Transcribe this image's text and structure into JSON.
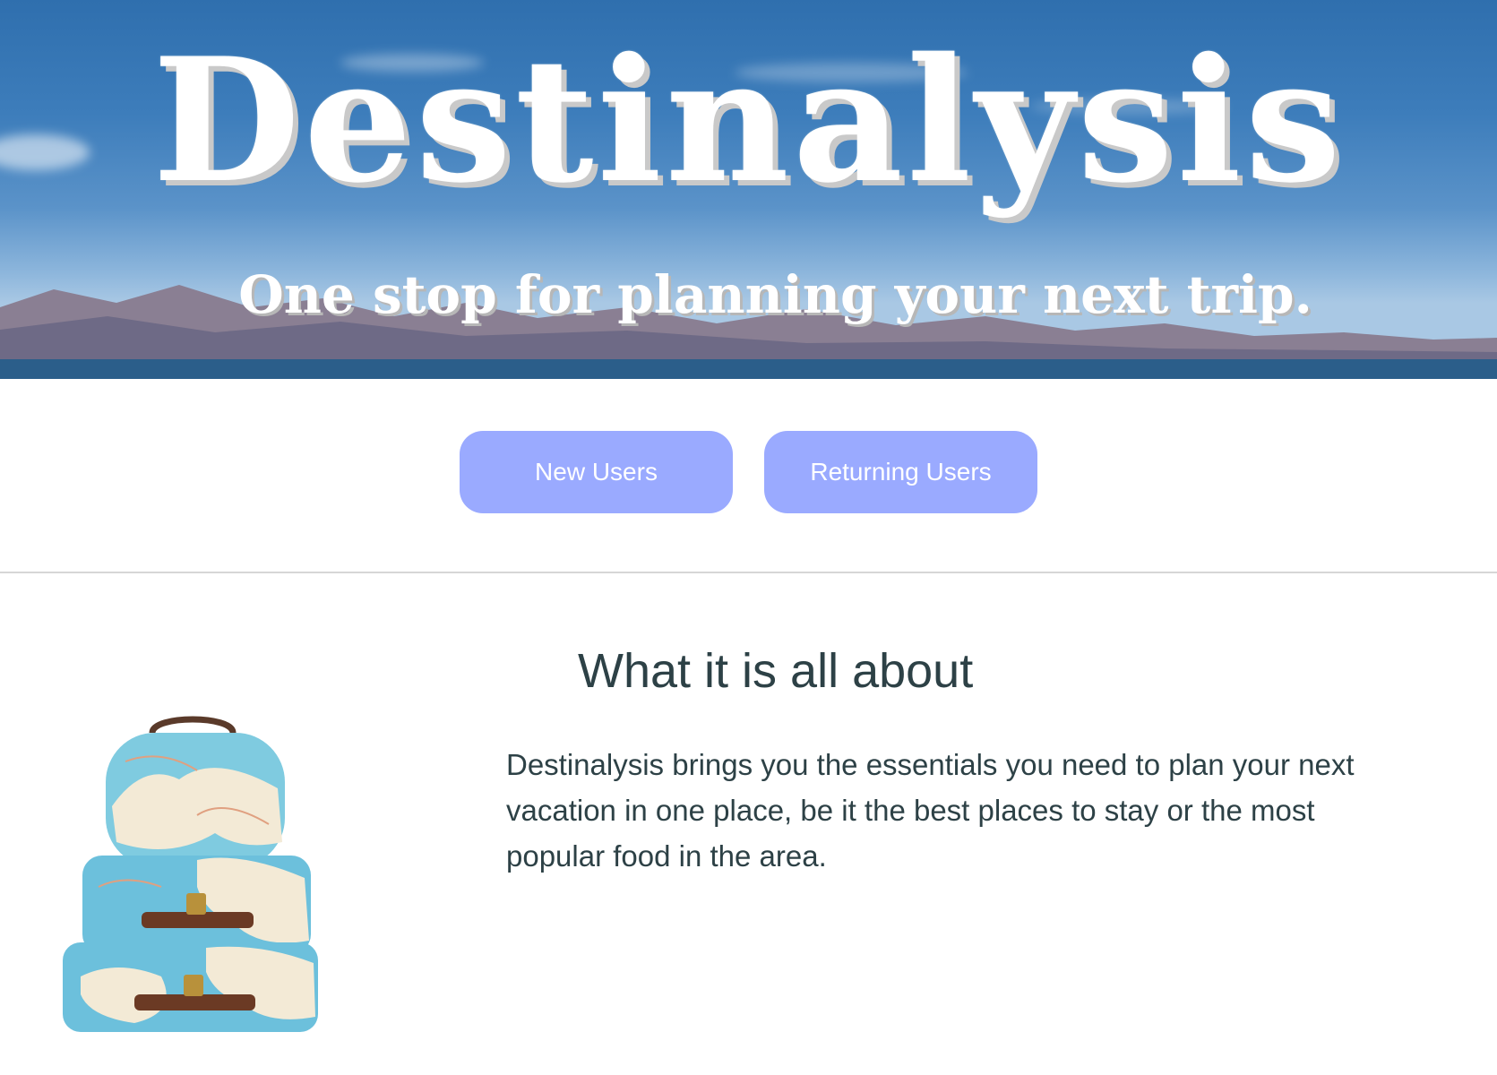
{
  "hero": {
    "title": "Destinalysis",
    "subtitle": "One stop for planning your next trip."
  },
  "buttons": {
    "new_users": "New Users",
    "returning_users": "Returning Users"
  },
  "about": {
    "heading": "What it is all about",
    "text": "Destinalysis brings you the essentials you need to plan your next vacation in one place, be it the best places to stay or the most popular food in the area."
  },
  "colors": {
    "button_bg": "#9aaaff",
    "text": "#2d4146",
    "sky": "#3d7dbb"
  },
  "icons": {
    "illustration": "suitcases-illustration"
  }
}
